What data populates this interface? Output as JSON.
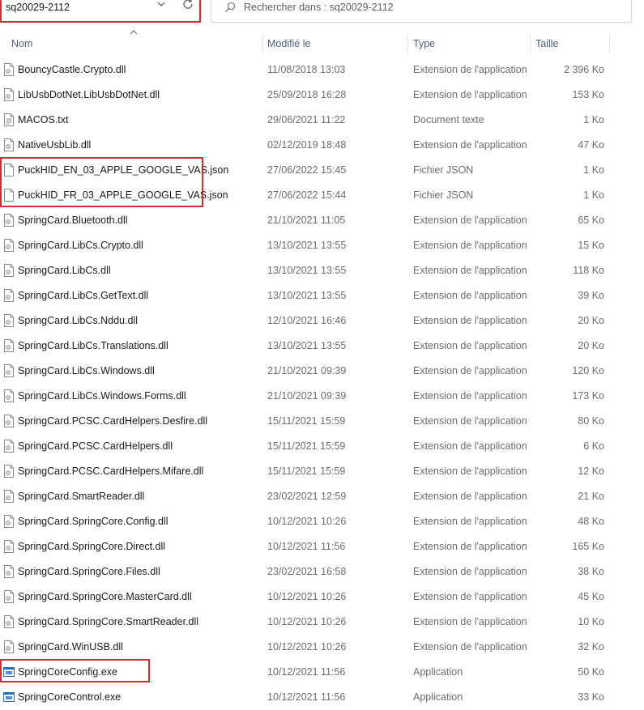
{
  "address": {
    "path": "sq20029-2112"
  },
  "search": {
    "placeholder": "Rechercher dans : sq20029-2112"
  },
  "columns": {
    "name": "Nom",
    "modified": "Modifié le",
    "type": "Type",
    "size": "Taille"
  },
  "files": [
    {
      "name": "BouncyCastle.Crypto.dll",
      "modified": "11/08/2018 13:03",
      "type": "Extension de l'application",
      "size": "2 396 Ko",
      "icon": "dll-file-icon"
    },
    {
      "name": "LibUsbDotNet.LibUsbDotNet.dll",
      "modified": "25/09/2018 16:28",
      "type": "Extension de l'application",
      "size": "153 Ko",
      "icon": "dll-file-icon"
    },
    {
      "name": "MACOS.txt",
      "modified": "29/06/2021 11:22",
      "type": "Document texte",
      "size": "1 Ko",
      "icon": "text-file-icon"
    },
    {
      "name": "NativeUsbLib.dll",
      "modified": "02/12/2019 18:48",
      "type": "Extension de l'application",
      "size": "47 Ko",
      "icon": "dll-file-icon"
    },
    {
      "name": "PuckHID_EN_03_APPLE_GOOGLE_VAS.json",
      "modified": "27/06/2022 15:45",
      "type": "Fichier JSON",
      "size": "1 Ko",
      "icon": "json-file-icon"
    },
    {
      "name": "PuckHID_FR_03_APPLE_GOOGLE_VAS.json",
      "modified": "27/06/2022 15:44",
      "type": "Fichier JSON",
      "size": "1 Ko",
      "icon": "json-file-icon"
    },
    {
      "name": "SpringCard.Bluetooth.dll",
      "modified": "21/10/2021 11:05",
      "type": "Extension de l'application",
      "size": "65 Ko",
      "icon": "dll-file-icon"
    },
    {
      "name": "SpringCard.LibCs.Crypto.dll",
      "modified": "13/10/2021 13:55",
      "type": "Extension de l'application",
      "size": "15 Ko",
      "icon": "dll-file-icon"
    },
    {
      "name": "SpringCard.LibCs.dll",
      "modified": "13/10/2021 13:55",
      "type": "Extension de l'application",
      "size": "118 Ko",
      "icon": "dll-file-icon"
    },
    {
      "name": "SpringCard.LibCs.GetText.dll",
      "modified": "13/10/2021 13:55",
      "type": "Extension de l'application",
      "size": "39 Ko",
      "icon": "dll-file-icon"
    },
    {
      "name": "SpringCard.LibCs.Nddu.dll",
      "modified": "12/10/2021 16:46",
      "type": "Extension de l'application",
      "size": "20 Ko",
      "icon": "dll-file-icon"
    },
    {
      "name": "SpringCard.LibCs.Translations.dll",
      "modified": "13/10/2021 13:55",
      "type": "Extension de l'application",
      "size": "20 Ko",
      "icon": "dll-file-icon"
    },
    {
      "name": "SpringCard.LibCs.Windows.dll",
      "modified": "21/10/2021 09:39",
      "type": "Extension de l'application",
      "size": "120 Ko",
      "icon": "dll-file-icon"
    },
    {
      "name": "SpringCard.LibCs.Windows.Forms.dll",
      "modified": "21/10/2021 09:39",
      "type": "Extension de l'application",
      "size": "173 Ko",
      "icon": "dll-file-icon"
    },
    {
      "name": "SpringCard.PCSC.CardHelpers.Desfire.dll",
      "modified": "15/11/2021 15:59",
      "type": "Extension de l'application",
      "size": "80 Ko",
      "icon": "dll-file-icon"
    },
    {
      "name": "SpringCard.PCSC.CardHelpers.dll",
      "modified": "15/11/2021 15:59",
      "type": "Extension de l'application",
      "size": "6 Ko",
      "icon": "dll-file-icon"
    },
    {
      "name": "SpringCard.PCSC.CardHelpers.Mifare.dll",
      "modified": "15/11/2021 15:59",
      "type": "Extension de l'application",
      "size": "12 Ko",
      "icon": "dll-file-icon"
    },
    {
      "name": "SpringCard.SmartReader.dll",
      "modified": "23/02/2021 12:59",
      "type": "Extension de l'application",
      "size": "21 Ko",
      "icon": "dll-file-icon"
    },
    {
      "name": "SpringCard.SpringCore.Config.dll",
      "modified": "10/12/2021 10:26",
      "type": "Extension de l'application",
      "size": "48 Ko",
      "icon": "dll-file-icon"
    },
    {
      "name": "SpringCard.SpringCore.Direct.dll",
      "modified": "10/12/2021 11:56",
      "type": "Extension de l'application",
      "size": "165 Ko",
      "icon": "dll-file-icon"
    },
    {
      "name": "SpringCard.SpringCore.Files.dll",
      "modified": "23/02/2021 16:58",
      "type": "Extension de l'application",
      "size": "38 Ko",
      "icon": "dll-file-icon"
    },
    {
      "name": "SpringCard.SpringCore.MasterCard.dll",
      "modified": "10/12/2021 10:26",
      "type": "Extension de l'application",
      "size": "45 Ko",
      "icon": "dll-file-icon"
    },
    {
      "name": "SpringCard.SpringCore.SmartReader.dll",
      "modified": "10/12/2021 10:26",
      "type": "Extension de l'application",
      "size": "10 Ko",
      "icon": "dll-file-icon"
    },
    {
      "name": "SpringCard.WinUSB.dll",
      "modified": "10/12/2021 10:26",
      "type": "Extension de l'application",
      "size": "32 Ko",
      "icon": "dll-file-icon"
    },
    {
      "name": "SpringCoreConfig.exe",
      "modified": "10/12/2021 11:56",
      "type": "Application",
      "size": "50 Ko",
      "icon": "application-exe-icon"
    },
    {
      "name": "SpringCoreControl.exe",
      "modified": "10/12/2021 11:56",
      "type": "Application",
      "size": "33 Ko",
      "icon": "application-exe-icon"
    }
  ],
  "colors": {
    "highlight": "#e0292e",
    "header_text": "#4c607a",
    "secondary_text": "#6d6d6d"
  }
}
